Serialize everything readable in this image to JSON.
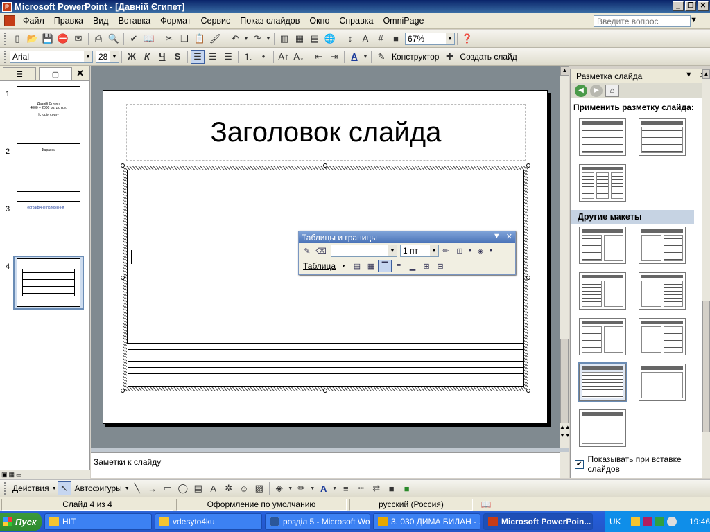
{
  "window": {
    "title": "Microsoft PowerPoint - [Давній Єгипет]"
  },
  "menu": {
    "items": [
      "Файл",
      "Правка",
      "Вид",
      "Вставка",
      "Формат",
      "Сервис",
      "Показ слайдов",
      "Окно",
      "Справка",
      "OmniPage"
    ],
    "help_placeholder": "Введите вопрос"
  },
  "toolbar_standard": {
    "zoom": "67%"
  },
  "toolbar_format": {
    "font": "Arial",
    "font_size": "28",
    "bold": "Ж",
    "italic": "К",
    "underline": "Ч",
    "shadow": "S",
    "designer": "Конструктор",
    "new_slide": "Создать слайд"
  },
  "slides_pane": {
    "thumbs": [
      {
        "num": "1",
        "lines": [
          "Давній Єгипет",
          "4000 – 2000 рр. до н.е.",
          "Історія ступу"
        ]
      },
      {
        "num": "2",
        "lines": [
          "Фараони"
        ]
      },
      {
        "num": "3",
        "lines": [
          "Географічне положення"
        ]
      },
      {
        "num": "4",
        "lines": []
      }
    ]
  },
  "slide": {
    "title": "Заголовок слайда",
    "table": {
      "rows": 8,
      "cols": 2
    }
  },
  "notes": {
    "placeholder": "Заметки к слайду"
  },
  "tables_toolbar": {
    "title": "Таблицы и границы",
    "line_width": "1 пт",
    "table_menu": "Таблица"
  },
  "task_pane": {
    "title": "Разметка слайда",
    "apply_label": "Применить разметку слайда:",
    "other_label": "Другие макеты",
    "show_on_insert": "Показывать при вставке слайдов"
  },
  "draw_toolbar": {
    "actions": "Действия",
    "autoshapes": "Автофигуры"
  },
  "status": {
    "slide": "Слайд 4 из 4",
    "design": "Оформление по умолчанию",
    "language": "русский (Россия)"
  },
  "taskbar": {
    "start": "Пуск",
    "tasks": [
      "HIT",
      "vdesyto4ku",
      "розділ 5 - Microsoft Word",
      "3. 030 ДИМА БИЛАН - ...",
      "Microsoft PowerPoin..."
    ],
    "lang": "UK",
    "time": "19:46"
  },
  "colors": {
    "title_bar": "#0a246a",
    "taskbar": "#245edb",
    "selection": "#6a8cb5"
  }
}
